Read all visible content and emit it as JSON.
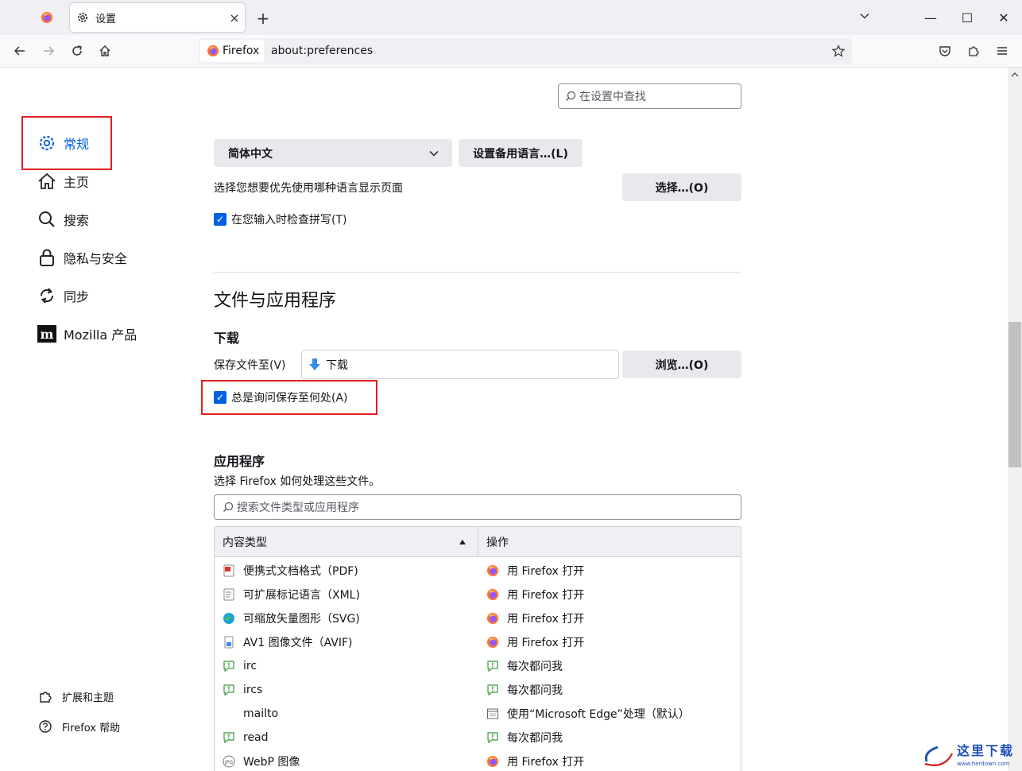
{
  "tabs": {
    "active_label": "设置",
    "close": "×",
    "new_tab": "+"
  },
  "window": {
    "minimize": "—",
    "maximize": "☐",
    "close": "✕"
  },
  "urlbar": {
    "identity": "Firefox",
    "url": "about:preferences"
  },
  "sidebar": {
    "items": [
      {
        "label": "常规",
        "icon": "gear-icon"
      },
      {
        "label": "主页",
        "icon": "home-icon"
      },
      {
        "label": "搜索",
        "icon": "search-icon"
      },
      {
        "label": "隐私与安全",
        "icon": "lock-icon"
      },
      {
        "label": "同步",
        "icon": "sync-icon"
      },
      {
        "label": "Mozilla 产品",
        "icon": "mozilla-icon"
      }
    ],
    "footer": [
      {
        "label": "扩展和主题",
        "icon": "puzzle-icon"
      },
      {
        "label": "Firefox 帮助",
        "icon": "help-icon"
      }
    ]
  },
  "main": {
    "search_placeholder": "在设置中查找",
    "language": {
      "selected": "简体中文",
      "alt_button": "设置备用语言…(L)",
      "choose_text": "选择您想要优先使用哪种语言显示页面",
      "choose_button": "选择…(O)",
      "spellcheck": "在您输入时检查拼写(T)"
    },
    "files_heading": "文件与应用程序",
    "downloads": {
      "heading": "下载",
      "save_label": "保存文件至(V)",
      "folder": "下载",
      "browse_button": "浏览…(O)",
      "always_ask": "总是询问保存至何处(A)"
    },
    "apps": {
      "heading": "应用程序",
      "description": "选择 Firefox 如何处理这些文件。",
      "search_placeholder": "搜索文件类型或应用程序",
      "col_type": "内容类型",
      "col_action": "操作",
      "rows": [
        {
          "type": "便携式文档格式（PDF)",
          "action": "用 Firefox 打开"
        },
        {
          "type": "可扩展标记语言（XML)",
          "action": "用 Firefox 打开"
        },
        {
          "type": "可缩放矢量图形（SVG)",
          "action": "用 Firefox 打开"
        },
        {
          "type": "AV1 图像文件（AVIF)",
          "action": "用 Firefox 打开"
        },
        {
          "type": "irc",
          "action": "每次都问我"
        },
        {
          "type": "ircs",
          "action": "每次都问我"
        },
        {
          "type": "mailto",
          "action": "使用“Microsoft Edge”处理（默认）"
        },
        {
          "type": "read",
          "action": "每次都问我"
        },
        {
          "type": "WebP 图像",
          "action": "用 Firefox 打开"
        }
      ]
    }
  },
  "watermark": "这里下载"
}
